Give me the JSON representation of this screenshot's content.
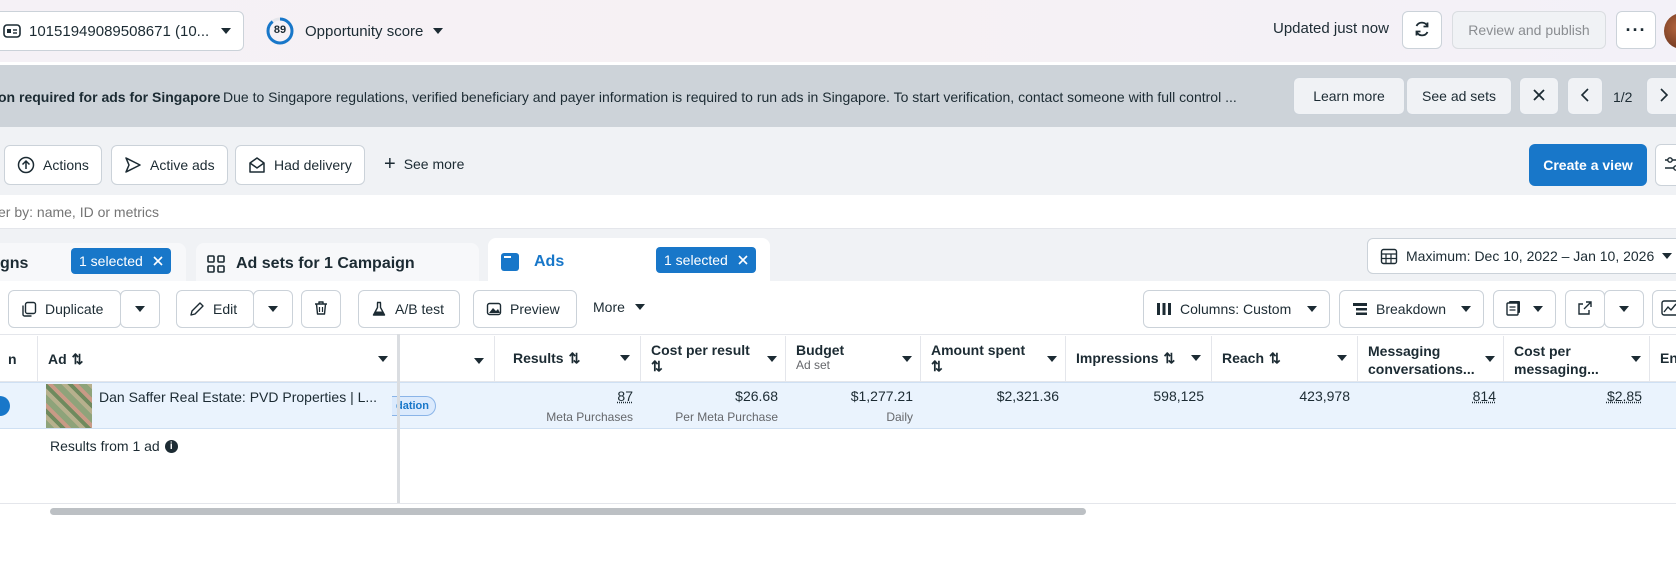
{
  "topbar": {
    "account_id": "10151949089508671 (10...",
    "score_value": "89",
    "score_label": "Opportunity score",
    "updated": "Updated just now",
    "review_label": "Review and publish"
  },
  "banner": {
    "title": "on required for ads for Singapore",
    "message": "Due to Singapore regulations, verified beneficiary and payer information is required to run ads in Singapore. To start verification, contact someone with full control ...",
    "learn_more": "Learn more",
    "see_ad_sets": "See ad sets",
    "pager": "1/2"
  },
  "filters": {
    "actions": "Actions",
    "active_ads": "Active ads",
    "had_delivery": "Had delivery",
    "see_more": "See more",
    "create_view": "Create a view"
  },
  "search": {
    "placeholder": "er by: name, ID or metrics"
  },
  "tabs": {
    "campaigns": "gns",
    "campaigns_selected": "1 selected",
    "adsets": "Ad sets for 1 Campaign",
    "ads": "Ads",
    "ads_selected": "1 selected",
    "date_range": "Maximum: Dec 10, 2022 – Jan 10, 2026"
  },
  "toolbar": {
    "duplicate": "Duplicate",
    "edit": "Edit",
    "ab_test": "A/B test",
    "preview": "Preview",
    "more": "More",
    "columns": "Columns: Custom",
    "breakdown": "Breakdown"
  },
  "table": {
    "headers": {
      "col0": "n",
      "ad": "Ad",
      "results": "Results",
      "cost_per_result": "Cost per result",
      "budget": "Budget",
      "budget_sub": "Ad set",
      "amount_spent": "Amount spent",
      "impressions": "Impressions",
      "reach": "Reach",
      "messaging": "Messaging conversations...",
      "cost_messaging": "Cost per messaging...",
      "next": "En"
    },
    "row": {
      "ad_name": "Dan Saffer Real Estate: PVD Properties | L...",
      "status_tag": "dation",
      "results": "87",
      "results_sub": "Meta Purchases",
      "cost_per_result": "$26.68",
      "cost_per_result_sub": "Per Meta Purchase",
      "budget": "$1,277.21",
      "budget_sub": "Daily",
      "amount_spent": "$2,321.36",
      "impressions": "598,125",
      "reach": "423,978",
      "messaging": "814",
      "cost_messaging": "$2.85"
    },
    "footer": "Results from 1 ad"
  },
  "colors": {
    "accent": "#1877c9",
    "banner_bg": "#cdd3d9",
    "row_selected": "#eaf3fd"
  }
}
